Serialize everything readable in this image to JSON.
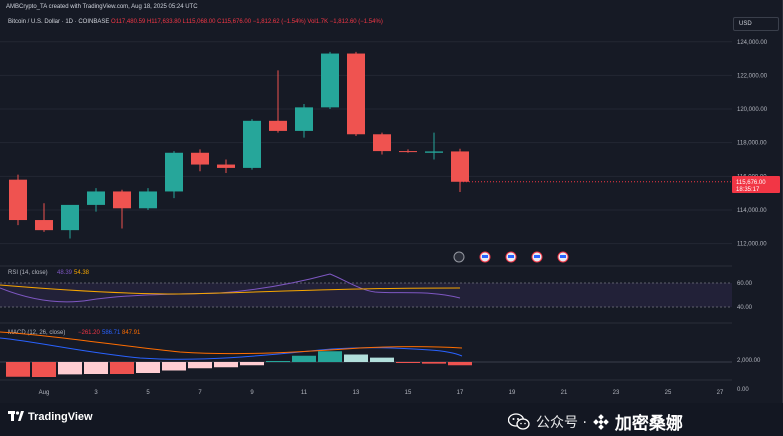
{
  "header": {
    "caption": "AMBCrypto_TA created with TradingView.com, Aug 18, 2025 05:24 UTC",
    "symbol": "Bitcoin / U.S. Dollar · 1D · COINBASE",
    "ohlc": "O117,480.59 H117,633.80 L115,068.00 C115,676.00 −1,812.62 (−1.54%)",
    "volume": "Vol1.7K −1,812.60 (−1.54%)",
    "currency": "USD"
  },
  "price_badge": {
    "price": "115,676.00",
    "countdown": "18:35:17",
    "color": "#f23645"
  },
  "colors": {
    "background": "#161a25",
    "up": "#26a69a",
    "down": "#ef5350",
    "rsi_line": "#7e57c2",
    "rsi_ma": "#f7a600",
    "macd_line": "#2962ff",
    "macd_signal": "#ff6d00"
  },
  "rsi": {
    "label": "RSI (14, close)",
    "value1": "48.39",
    "value2": "54.38",
    "levels": [
      "60.00",
      "40.00"
    ]
  },
  "macd": {
    "label": "MACD (12, 26, close)",
    "hist_value": "−261.20",
    "macd_value": "586.71",
    "signal_value": "847.91",
    "levels": [
      "2,000.00",
      "0.00"
    ]
  },
  "footer": {
    "brand": "TradingView",
    "watermark_prefix": "公众号 ·",
    "watermark_name": "加密桑娜"
  },
  "chart_data": {
    "type": "candlestick",
    "x_ticks": [
      "Aug",
      "3",
      "5",
      "7",
      "9",
      "11",
      "13",
      "15",
      "17",
      "19",
      "21",
      "23",
      "25",
      "27"
    ],
    "y_ticks": [
      "124,000.00",
      "122,000.00",
      "120,000.00",
      "118,000.00",
      "116,000.00",
      "114,000.00",
      "112,000.00"
    ],
    "ylim": [
      111500,
      124700
    ],
    "candles": [
      {
        "date": "Jul 31",
        "o": 115800,
        "h": 116100,
        "l": 113100,
        "c": 113400
      },
      {
        "date": "Aug 1",
        "o": 113400,
        "h": 114400,
        "l": 112700,
        "c": 112800
      },
      {
        "date": "Aug 2",
        "o": 112800,
        "h": 114100,
        "l": 112300,
        "c": 114300
      },
      {
        "date": "Aug 3",
        "o": 114300,
        "h": 115300,
        "l": 113900,
        "c": 115100
      },
      {
        "date": "Aug 4",
        "o": 115100,
        "h": 115200,
        "l": 112900,
        "c": 114100
      },
      {
        "date": "Aug 5",
        "o": 114100,
        "h": 115300,
        "l": 114000,
        "c": 115100
      },
      {
        "date": "Aug 6",
        "o": 115100,
        "h": 117500,
        "l": 114700,
        "c": 117400
      },
      {
        "date": "Aug 7",
        "o": 117400,
        "h": 117600,
        "l": 116300,
        "c": 116700
      },
      {
        "date": "Aug 8",
        "o": 116700,
        "h": 117000,
        "l": 116200,
        "c": 116500
      },
      {
        "date": "Aug 9",
        "o": 116500,
        "h": 119400,
        "l": 116400,
        "c": 119300
      },
      {
        "date": "Aug 10",
        "o": 119300,
        "h": 122300,
        "l": 118600,
        "c": 118700
      },
      {
        "date": "Aug 11",
        "o": 118700,
        "h": 120300,
        "l": 118300,
        "c": 120100
      },
      {
        "date": "Aug 12",
        "o": 120100,
        "h": 123400,
        "l": 120000,
        "c": 123300
      },
      {
        "date": "Aug 13",
        "o": 123300,
        "h": 123400,
        "l": 118400,
        "c": 118500
      },
      {
        "date": "Aug 14",
        "o": 118500,
        "h": 118600,
        "l": 117300,
        "c": 117500
      },
      {
        "date": "Aug 15",
        "o": 117500,
        "h": 117600,
        "l": 117400,
        "c": 117450
      },
      {
        "date": "Aug 16",
        "o": 117400,
        "h": 118600,
        "l": 117000,
        "c": 117480
      },
      {
        "date": "Aug 17",
        "o": 117480,
        "h": 117640,
        "l": 115070,
        "c": 115676
      }
    ],
    "macd_histogram": [
      -1180,
      -1200,
      -990,
      -960,
      -960,
      -880,
      -680,
      -500,
      -420,
      -260,
      80,
      500,
      860,
      600,
      350,
      -20,
      -130,
      -261
    ]
  }
}
